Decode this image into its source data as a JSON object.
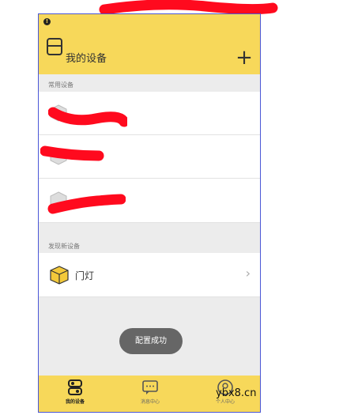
{
  "header": {
    "title": "我的设备",
    "add_label": "+"
  },
  "sections": {
    "frequent": "常用设备",
    "discovered": "发现新设备"
  },
  "new_device": {
    "name": "门灯"
  },
  "toast": "配置成功",
  "tabs": [
    {
      "label": "我的设备",
      "icon": "devices-icon"
    },
    {
      "label": "消息中心",
      "icon": "message-icon"
    },
    {
      "label": "个人中心",
      "icon": "person-icon"
    }
  ],
  "watermark": "ybx8.cn",
  "colors": {
    "brand_yellow": "#f7d85a",
    "background": "#ececec",
    "redaction": "#ff0a1e"
  }
}
